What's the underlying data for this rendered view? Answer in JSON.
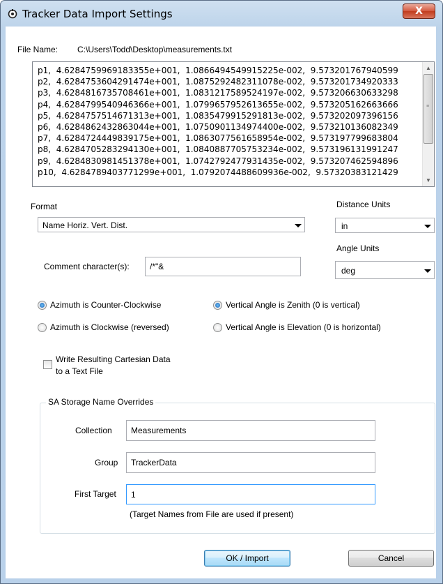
{
  "window": {
    "title": "Tracker Data Import Settings",
    "close_label": "X"
  },
  "file": {
    "label": "File Name:",
    "path": "C:\\Users\\Todd\\Desktop\\measurements.txt"
  },
  "data_lines": [
    "p1,  4.6284759969183355e+001,  1.0866494549915225e-002,  9.573201767940599",
    "p2,  4.6284753604291474e+001,  1.0875292482311078e-002,  9.573201734920333",
    "p3,  4.6284816735708461e+001,  1.0831217589524197e-002,  9.573206630633298",
    "p4,  4.6284799540946366e+001,  1.0799657952613655e-002,  9.573205162663666",
    "p5,  4.6284757514671313e+001,  1.0835479915291813e-002,  9.573202097396156",
    "p6,  4.6284862432863044e+001,  1.0750901134974400e-002,  9.573210136082349",
    "p7,  4.6284724449839175e+001,  1.0863077561658954e-002,  9.573197799683804",
    "p8,  4.6284705283294130e+001,  1.0840887705753234e-002,  9.573196131991247",
    "p9,  4.6284830981451378e+001,  1.0742792477931435e-002,  9.573207462594896",
    "p10,  4.6284789403771299e+001,  1.0792074488609936e-002,  9.57320383121429"
  ],
  "format": {
    "label": "Format",
    "value": "Name Horiz. Vert. Dist."
  },
  "distance_units": {
    "label": "Distance Units",
    "value": "in"
  },
  "angle_units": {
    "label": "Angle Units",
    "value": "deg"
  },
  "comment": {
    "label": "Comment character(s):",
    "value": "/*\"&"
  },
  "azimuth": {
    "ccw_label": "Azimuth is Counter-Clockwise",
    "cw_label": "Azimuth is Clockwise (reversed)",
    "selected": "ccw"
  },
  "vertical": {
    "zenith_label": "Vertical Angle is Zenith (0 is vertical)",
    "elevation_label": "Vertical Angle is Elevation (0 is horizontal)",
    "selected": "zenith"
  },
  "write_file": {
    "label_line1": "Write Resulting Cartesian Data",
    "label_line2": "to a Text File",
    "checked": false
  },
  "overrides": {
    "title": "SA Storage Name Overrides",
    "collection_label": "Collection",
    "collection_value": "Measurements",
    "group_label": "Group",
    "group_value": "TrackerData",
    "first_target_label": "First Target",
    "first_target_value": "1",
    "note": "(Target Names from File are used if present)"
  },
  "buttons": {
    "ok": "OK / Import",
    "cancel": "Cancel"
  }
}
